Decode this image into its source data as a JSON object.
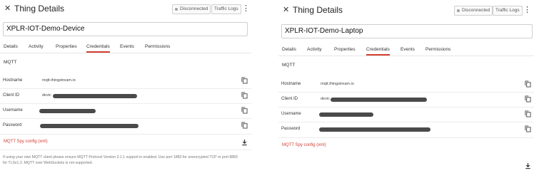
{
  "panels": [
    {
      "title": "Thing Details",
      "status": "Disconnected",
      "traffic_logs": "Traffic Logs",
      "thing_name": "XPLR-IOT-Demo-Device",
      "tabs": [
        "Details",
        "Activity",
        "Properties",
        "Credentials",
        "Events",
        "Permissions"
      ],
      "active_tab": "Credentials",
      "section": "MQTT",
      "fields": [
        {
          "label": "Hostname",
          "value": "mqtt.thingstream.io"
        },
        {
          "label": "Client ID",
          "value": "devic"
        },
        {
          "label": "Username",
          "value": ""
        },
        {
          "label": "Password",
          "value": ""
        }
      ],
      "spy_config": "MQTT Spy config (xml)",
      "note": "If using your own MQTT client please ensure MQTT Protocol Version 3.1.1 support is enabled. Use port 1883 for unencrypted TCP or port 8883 for TLSv1.2. MQTT over WebSockets is not supported."
    },
    {
      "title": "Thing Details",
      "status": "Disconnected",
      "traffic_logs": "Traffic Logs",
      "thing_name": "XPLR-IOT-Demo-Laptop",
      "tabs": [
        "Details",
        "Activity",
        "Properties",
        "Credentials",
        "Events",
        "Permissions"
      ],
      "active_tab": "Credentials",
      "section": "MQTT",
      "fields": [
        {
          "label": "Hostname",
          "value": "mqtt.thingstream.io"
        },
        {
          "label": "Client ID",
          "value": "devic"
        },
        {
          "label": "Username",
          "value": ""
        },
        {
          "label": "Password",
          "value": ""
        }
      ],
      "spy_config": "MQTT Spy config (xml)"
    }
  ],
  "colors": {
    "accent": "#d23f31",
    "redaction": "#4a4a4a"
  },
  "icons": [
    "close-icon",
    "more-vert-icon",
    "copy-icon",
    "download-icon"
  ]
}
